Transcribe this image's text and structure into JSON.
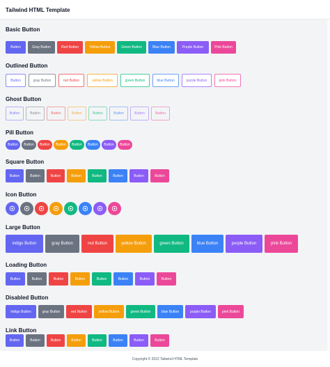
{
  "header": {
    "title": "Tailwind HTML Template"
  },
  "colors": {
    "indigo": "#6366f1",
    "gray": "#6b7280",
    "red": "#ef4444",
    "yellow": "#f59e0b",
    "green": "#10b981",
    "blue": "#3b82f6",
    "purple": "#8b5cf6",
    "pink": "#ec4899"
  },
  "sections": {
    "basic": {
      "title": "Basic Button",
      "buttons": [
        "Button",
        "Gray Button",
        "Red Button",
        "Yellow Button",
        "Green Button",
        "Blue Button",
        "Purple Button",
        "Pink Button"
      ]
    },
    "outlined": {
      "title": "Outlined Button",
      "buttons": [
        "Button",
        "gray Button",
        "red Button",
        "yellow Button",
        "green Button",
        "blue Button",
        "purple Button",
        "pink Button"
      ]
    },
    "ghost": {
      "title": "Ghost Button",
      "buttons": [
        "Button",
        "Button",
        "Button",
        "Button",
        "Button",
        "Button",
        "Button",
        "Button"
      ]
    },
    "pill": {
      "title": "Pill Button",
      "buttons": [
        "Button",
        "Button",
        "Button",
        "Button",
        "Button",
        "Button",
        "Button",
        "Button"
      ]
    },
    "square": {
      "title": "Square Button",
      "buttons": [
        "Button",
        "Button",
        "Button",
        "Button",
        "Button",
        "Button",
        "Button",
        "Button"
      ]
    },
    "icon": {
      "title": "Icon Button",
      "icon": "plus-circle-icon"
    },
    "large": {
      "title": "Large Button",
      "buttons": [
        "indigo Button",
        "gray Button",
        "red Button",
        "yellow Button",
        "green Button",
        "blue Button",
        "purple Button",
        "pink Button"
      ]
    },
    "loading": {
      "title": "Loading Button",
      "buttons": [
        "Button",
        "Button",
        "Button",
        "Button",
        "Button",
        "Button",
        "Button",
        "Button"
      ]
    },
    "disabled": {
      "title": "Disabled Button",
      "buttons": [
        "Indigo Button",
        "gray Button",
        "red Button",
        "yellow Button",
        "green Button",
        "blue Button",
        "purple Button",
        "pink Button"
      ]
    },
    "link": {
      "title": "Link Button",
      "buttons": [
        "Button",
        "Button",
        "Button",
        "Button",
        "Button",
        "Button",
        "Button",
        "Button"
      ]
    }
  },
  "footer": {
    "text": "Copyright © 2022 Tailwind HTML Template"
  }
}
